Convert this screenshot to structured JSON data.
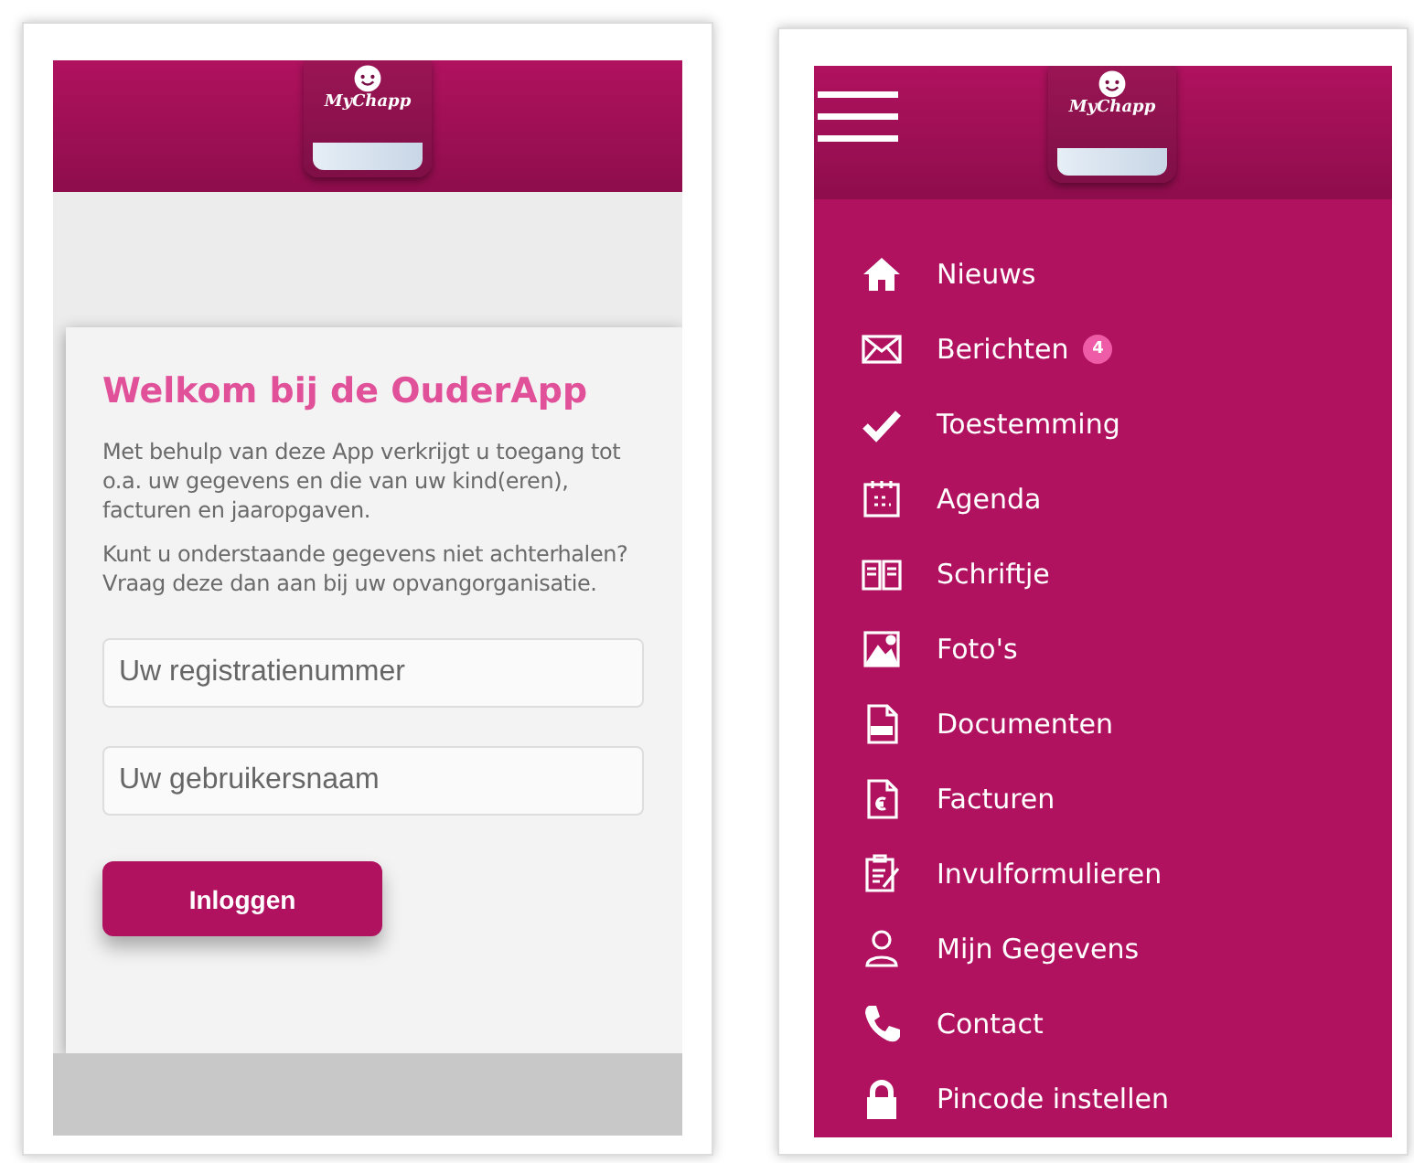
{
  "login_screen": {
    "logo_text": "MyChapp",
    "title": "Welkom bij de OuderApp",
    "paragraphs": [
      "Met behulp van deze App verkrijgt u toegang tot o.a. uw gegevens en die van uw kind(eren), facturen en jaaropgaven.",
      "Kunt u onderstaande gegevens niet achterhalen?\nVraag deze dan aan bij uw opvangorganisatie."
    ],
    "fields": [
      {
        "placeholder": "Uw registratienummer"
      },
      {
        "placeholder": "Uw gebruikersnaam"
      }
    ],
    "button": "Inloggen"
  },
  "menu_screen": {
    "logo_text": "MyChapp",
    "items": [
      {
        "label": "Nieuws"
      },
      {
        "label": "Berichten",
        "badge": "4"
      },
      {
        "label": "Toestemming"
      },
      {
        "label": "Agenda"
      },
      {
        "label": "Schriftje"
      },
      {
        "label": "Foto's"
      },
      {
        "label": "Documenten"
      },
      {
        "label": "Facturen"
      },
      {
        "label": "Invulformulieren"
      },
      {
        "label": "Mijn Gegevens"
      },
      {
        "label": "Contact"
      },
      {
        "label": "Pincode instellen"
      }
    ]
  }
}
